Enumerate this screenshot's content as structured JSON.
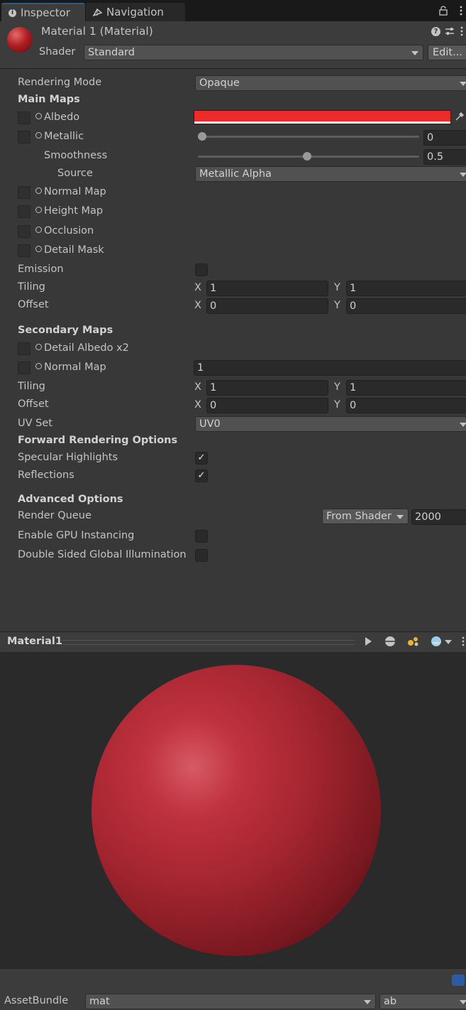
{
  "tabs": [
    {
      "label": "Inspector",
      "icon": "info-icon",
      "active": true
    },
    {
      "label": "Navigation",
      "icon": "navmesh-icon",
      "active": false
    }
  ],
  "header": {
    "title": "Material 1 (Material)",
    "shader_label": "Shader",
    "shader_value": "Standard",
    "edit_button": "Edit..."
  },
  "props": {
    "rendering_mode_label": "Rendering Mode",
    "rendering_mode_value": "Opaque",
    "main_maps": "Main Maps",
    "albedo": "Albedo",
    "albedo_color": "#ee2b2b",
    "metallic": "Metallic",
    "metallic_value": "0",
    "metallic_fraction": 0,
    "smoothness": "Smoothness",
    "smoothness_value": "0.5",
    "smoothness_fraction": 0.5,
    "source": "Source",
    "source_value": "Metallic Alpha",
    "normal_map": "Normal Map",
    "height_map": "Height Map",
    "occlusion": "Occlusion",
    "detail_mask": "Detail Mask",
    "emission": "Emission",
    "tiling": "Tiling",
    "offset": "Offset",
    "x": "X",
    "y": "Y",
    "tiling_x": "1",
    "tiling_y": "1",
    "offset_x": "0",
    "offset_y": "0",
    "secondary_maps": "Secondary Maps",
    "detail_albedo": "Detail Albedo x2",
    "sec_normal_map": "Normal Map",
    "sec_normal_value": "1",
    "sec_tiling_x": "1",
    "sec_tiling_y": "1",
    "sec_offset_x": "0",
    "sec_offset_y": "0",
    "uv_set": "UV Set",
    "uv_set_value": "UV0",
    "forward_options": "Forward Rendering Options",
    "specular": "Specular Highlights",
    "specular_checked": true,
    "reflections": "Reflections",
    "reflections_checked": true,
    "advanced": "Advanced Options",
    "render_queue": "Render Queue",
    "render_queue_mode": "From Shader",
    "render_queue_value": "2000",
    "gpu_instancing": "Enable GPU Instancing",
    "double_sided_gi": "Double Sided Global Illumination"
  },
  "preview": {
    "title": "Material1",
    "sphere_color": "#b0293a"
  },
  "footer": {
    "asset_bundle_label": "AssetBundle",
    "bundle_value": "mat",
    "variant_value": "ab"
  },
  "check_glyph": "✓"
}
